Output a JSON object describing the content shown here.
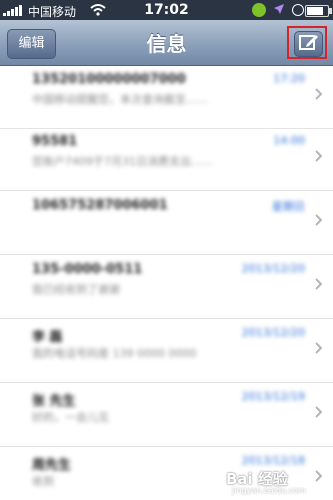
{
  "status_bar": {
    "carrier": "中国移动",
    "time": "17:02",
    "battery_level": 0.8
  },
  "nav_bar": {
    "edit_label": "编辑",
    "title": "信息",
    "compose_icon": "compose-icon"
  },
  "messages": [
    {
      "name": "13520100000007000",
      "date": "17:20",
      "preview": "中国移动提醒您，本次查询截至……"
    },
    {
      "name": "95581",
      "date": "14:00",
      "preview": "您账户7409于7月31日消费支出……"
    },
    {
      "name": "106575287006001",
      "date": "星期日",
      "preview": ""
    },
    {
      "name": "135-0000-0511",
      "date": "2013/12/20",
      "preview": "我已经收到了谢谢"
    },
    {
      "name": "李 磊",
      "date": "2013/12/20",
      "preview": "我的电话号码是 139 0000 0000"
    },
    {
      "name": "张 先生",
      "date": "2013/12/19",
      "preview": "好的，一会儿见"
    },
    {
      "name": "周先生",
      "date": "2013/12/18",
      "preview": "收到"
    }
  ],
  "watermark": {
    "text": "Bai 经验",
    "url": "jingyan.baidu.com"
  },
  "colors": {
    "status_bar": "#2a3442",
    "nav_bar": "#8fa3bc",
    "date_text": "#2f6fd8",
    "highlight": "#d8232a"
  }
}
